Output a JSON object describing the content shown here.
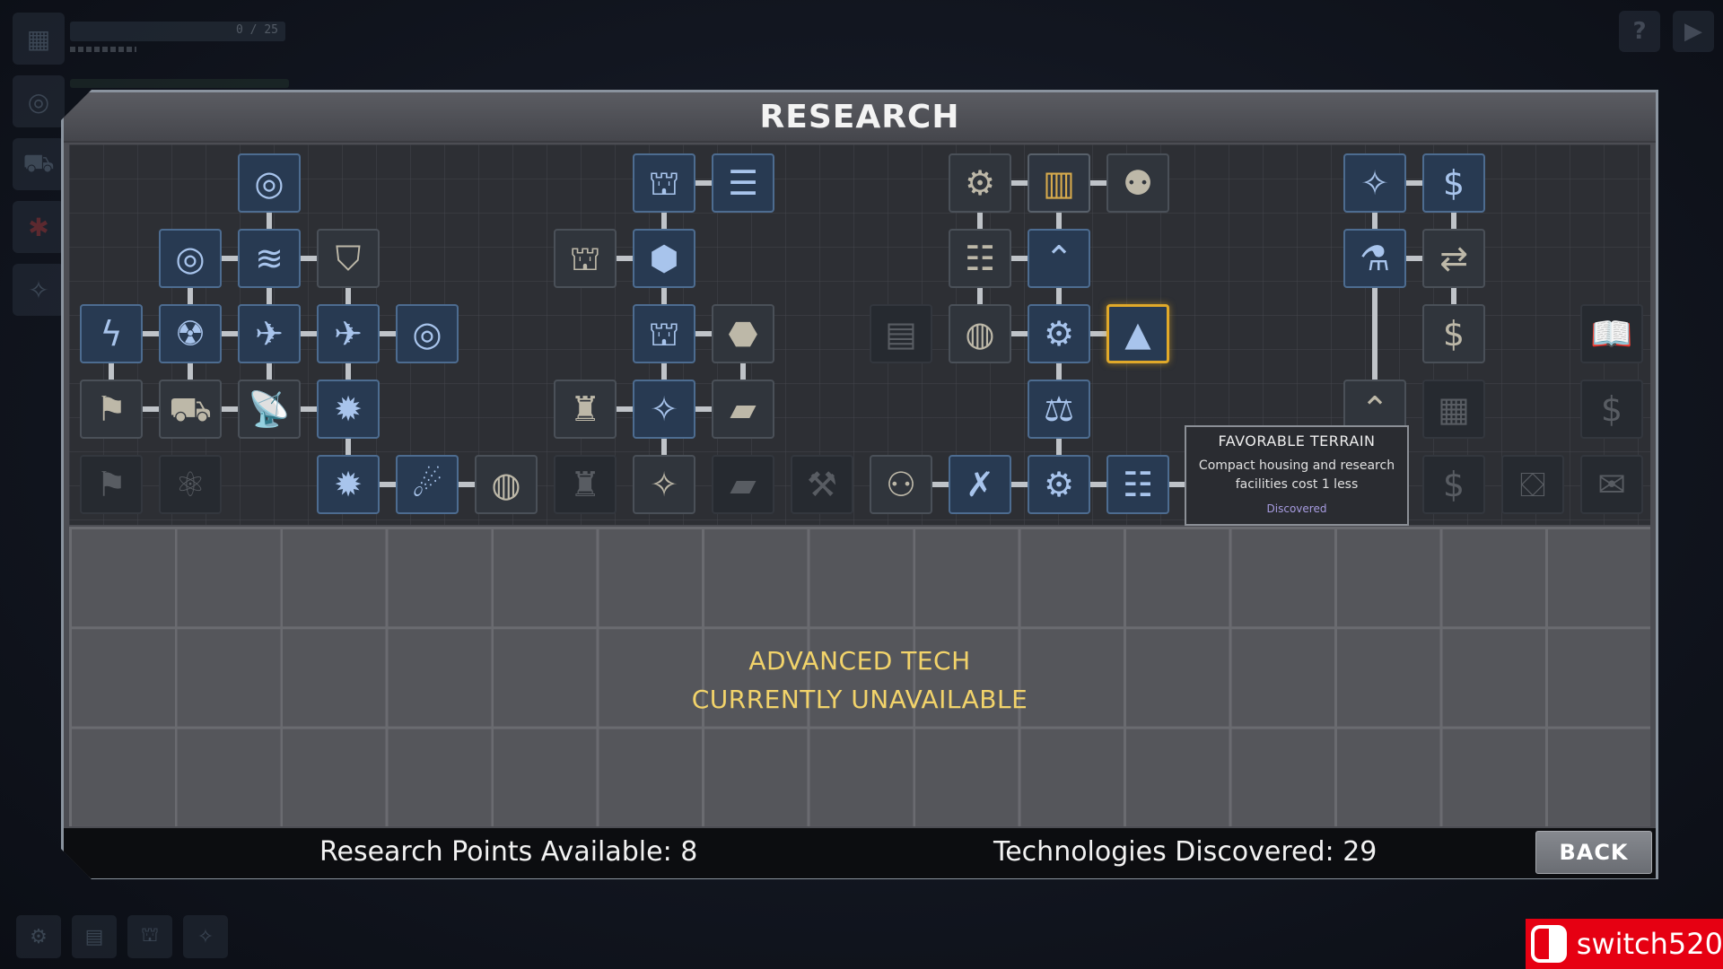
{
  "background": {
    "hud_progress": "0 / 25"
  },
  "panel": {
    "title": "RESEARCH"
  },
  "tree": {
    "nodes": [
      {
        "id": "n1",
        "col": 3,
        "row": 0,
        "state": "discovered",
        "icon": "radar-icon",
        "glyph": "◎"
      },
      {
        "id": "n2",
        "col": 2,
        "row": 1,
        "state": "discovered",
        "icon": "radar-icon",
        "glyph": "◎"
      },
      {
        "id": "n3",
        "col": 3,
        "row": 1,
        "state": "discovered",
        "icon": "signal-wave-icon",
        "glyph": "≋"
      },
      {
        "id": "n4",
        "col": 4,
        "row": 1,
        "state": "available",
        "icon": "shield-icon",
        "glyph": "⛉"
      },
      {
        "id": "n5",
        "col": 1,
        "row": 2,
        "state": "discovered",
        "icon": "lightning-icon",
        "glyph": "ϟ"
      },
      {
        "id": "n6",
        "col": 2,
        "row": 2,
        "state": "discovered",
        "icon": "reactor-icon",
        "glyph": "☢"
      },
      {
        "id": "n7",
        "col": 3,
        "row": 2,
        "state": "discovered",
        "icon": "spaceship-icon",
        "glyph": "✈"
      },
      {
        "id": "n8",
        "col": 4,
        "row": 2,
        "state": "discovered",
        "icon": "spaceship-icon",
        "glyph": "✈"
      },
      {
        "id": "n9",
        "col": 5,
        "row": 2,
        "state": "discovered",
        "icon": "radar-icon",
        "glyph": "◎"
      },
      {
        "id": "n10",
        "col": 1,
        "row": 3,
        "state": "available",
        "icon": "banner-icon",
        "glyph": "⚑"
      },
      {
        "id": "n11",
        "col": 2,
        "row": 3,
        "state": "available",
        "icon": "rover-icon",
        "glyph": "⛟"
      },
      {
        "id": "n12",
        "col": 3,
        "row": 3,
        "state": "available",
        "icon": "satellite-dish-icon",
        "glyph": "📡"
      },
      {
        "id": "n13",
        "col": 4,
        "row": 3,
        "state": "discovered",
        "icon": "spiked-mine-icon",
        "glyph": "✹"
      },
      {
        "id": "n14",
        "col": 1,
        "row": 4,
        "state": "locked",
        "icon": "banner-icon",
        "glyph": "⚑"
      },
      {
        "id": "n15",
        "col": 2,
        "row": 4,
        "state": "locked",
        "icon": "atom-icon",
        "glyph": "⚛"
      },
      {
        "id": "n16",
        "col": 4,
        "row": 4,
        "state": "discovered",
        "icon": "spiked-mine-icon",
        "glyph": "✹"
      },
      {
        "id": "n17",
        "col": 5,
        "row": 4,
        "state": "discovered",
        "icon": "comet-icon",
        "glyph": "☄"
      },
      {
        "id": "n18",
        "col": 6,
        "row": 4,
        "state": "available",
        "icon": "planet-icon",
        "glyph": "◍"
      },
      {
        "id": "n19",
        "col": 8,
        "row": 0,
        "state": "discovered",
        "icon": "oil-rig-icon",
        "glyph": "⛫"
      },
      {
        "id": "n20",
        "col": 9,
        "row": 0,
        "state": "discovered",
        "icon": "column-icon",
        "glyph": "☰"
      },
      {
        "id": "n21",
        "col": 7,
        "row": 1,
        "state": "available",
        "icon": "oil-rig-icon",
        "glyph": "⛫"
      },
      {
        "id": "n22",
        "col": 8,
        "row": 1,
        "state": "discovered",
        "icon": "cube-icon",
        "glyph": "⬢"
      },
      {
        "id": "n23",
        "col": 8,
        "row": 2,
        "state": "discovered",
        "icon": "oil-rig-icon",
        "glyph": "⛫"
      },
      {
        "id": "n24",
        "col": 9,
        "row": 2,
        "state": "available",
        "icon": "blocks-icon",
        "glyph": "⬣"
      },
      {
        "id": "n25",
        "col": 7,
        "row": 3,
        "state": "available",
        "icon": "mech-suit-icon",
        "glyph": "♜"
      },
      {
        "id": "n26",
        "col": 8,
        "row": 3,
        "state": "discovered",
        "icon": "crystal-icon",
        "glyph": "✧"
      },
      {
        "id": "n27",
        "col": 9,
        "row": 3,
        "state": "available",
        "icon": "ingot-icon",
        "glyph": "▰"
      },
      {
        "id": "n28",
        "col": 7,
        "row": 4,
        "state": "locked",
        "icon": "mech-suit-icon",
        "glyph": "♜"
      },
      {
        "id": "n29",
        "col": 8,
        "row": 4,
        "state": "available",
        "icon": "crystal-icon",
        "glyph": "✧"
      },
      {
        "id": "n30",
        "col": 9,
        "row": 4,
        "state": "locked",
        "icon": "ingot-icon",
        "glyph": "▰"
      },
      {
        "id": "n31",
        "col": 10,
        "row": 4,
        "state": "locked",
        "icon": "drill-icon",
        "glyph": "⚒"
      },
      {
        "id": "n32",
        "col": 11,
        "row": 2,
        "state": "locked",
        "icon": "money-stack-icon",
        "glyph": "▤"
      },
      {
        "id": "n33",
        "col": 11,
        "row": 4,
        "state": "available",
        "icon": "hierarchy-icon",
        "glyph": "⚇"
      },
      {
        "id": "n34",
        "col": 12,
        "row": 0,
        "state": "available",
        "icon": "gear-wrench-icon",
        "glyph": "⚙"
      },
      {
        "id": "n35",
        "col": 13,
        "row": 0,
        "state": "gold",
        "icon": "city-icon",
        "glyph": "▥"
      },
      {
        "id": "n36",
        "col": 14,
        "row": 0,
        "state": "available",
        "icon": "population-icon",
        "glyph": "⚉"
      },
      {
        "id": "n37",
        "col": 12,
        "row": 1,
        "state": "available",
        "icon": "layers-icon",
        "glyph": "☷"
      },
      {
        "id": "n38",
        "col": 13,
        "row": 1,
        "state": "discovered",
        "icon": "rank-chevron-icon",
        "glyph": "⌃"
      },
      {
        "id": "n39",
        "col": 12,
        "row": 2,
        "state": "available",
        "icon": "planet-icon",
        "glyph": "◍"
      },
      {
        "id": "n40",
        "col": 13,
        "row": 2,
        "state": "discovered",
        "icon": "gear-wrench-icon",
        "glyph": "⚙"
      },
      {
        "id": "n41",
        "col": 14,
        "row": 2,
        "state": "discovered",
        "icon": "mountain-icon",
        "glyph": "▲",
        "selected": true
      },
      {
        "id": "n42",
        "col": 13,
        "row": 3,
        "state": "discovered",
        "icon": "balance-scale-icon",
        "glyph": "⚖"
      },
      {
        "id": "n43",
        "col": 12,
        "row": 4,
        "state": "discovered",
        "icon": "wrench-cross-icon",
        "glyph": "✗"
      },
      {
        "id": "n44",
        "col": 13,
        "row": 4,
        "state": "discovered",
        "icon": "gear-wrench-icon",
        "glyph": "⚙"
      },
      {
        "id": "n45",
        "col": 14,
        "row": 4,
        "state": "discovered",
        "icon": "layers-icon",
        "glyph": "☷"
      },
      {
        "id": "n46",
        "col": 15,
        "row": 4,
        "state": "available",
        "icon": "pyramid-icon",
        "glyph": "▲"
      },
      {
        "id": "n47",
        "col": 16,
        "row": 4,
        "state": "locked",
        "icon": "cross-swords-icon",
        "glyph": "✕"
      },
      {
        "id": "n48",
        "col": 17,
        "row": 0,
        "state": "discovered",
        "icon": "crystal-icon",
        "glyph": "✧"
      },
      {
        "id": "n49",
        "col": 18,
        "row": 0,
        "state": "discovered",
        "icon": "coin-bag-icon",
        "glyph": "$"
      },
      {
        "id": "n50",
        "col": 17,
        "row": 1,
        "state": "discovered",
        "icon": "flask-icon",
        "glyph": "⚗"
      },
      {
        "id": "n51",
        "col": 18,
        "row": 1,
        "state": "available",
        "icon": "exchange-icon",
        "glyph": "⇄"
      },
      {
        "id": "n52",
        "col": 18,
        "row": 2,
        "state": "available",
        "icon": "coin-bag-icon",
        "glyph": "$"
      },
      {
        "id": "n53",
        "col": 17,
        "row": 3,
        "state": "available",
        "icon": "rank-chevron-icon",
        "glyph": "⌃"
      },
      {
        "id": "n54",
        "col": 18,
        "row": 3,
        "state": "locked",
        "icon": "bricks-icon",
        "glyph": "▦"
      },
      {
        "id": "n55",
        "col": 17,
        "row": 4,
        "state": "locked",
        "icon": "rank-chevron-icon",
        "glyph": "⌃"
      },
      {
        "id": "n56",
        "col": 18,
        "row": 4,
        "state": "locked",
        "icon": "coin-bag-icon",
        "glyph": "$"
      },
      {
        "id": "n57",
        "col": 19,
        "row": 4,
        "state": "locked",
        "icon": "treasure-chest-icon",
        "glyph": "⛋"
      },
      {
        "id": "n58",
        "col": 20,
        "row": 2,
        "state": "locked",
        "icon": "book-icon",
        "glyph": "📖"
      },
      {
        "id": "n59",
        "col": 20,
        "row": 3,
        "state": "locked",
        "icon": "coin-bag-icon",
        "glyph": "$"
      },
      {
        "id": "n60",
        "col": 20,
        "row": 4,
        "state": "locked",
        "icon": "chat-bubbles-icon",
        "glyph": "✉"
      }
    ],
    "links": [
      [
        "n1",
        "n3"
      ],
      [
        "n2",
        "n3"
      ],
      [
        "n3",
        "n4"
      ],
      [
        "n2",
        "n6"
      ],
      [
        "n3",
        "n7"
      ],
      [
        "n4",
        "n8"
      ],
      [
        "n5",
        "n6"
      ],
      [
        "n6",
        "n7"
      ],
      [
        "n7",
        "n8"
      ],
      [
        "n8",
        "n9"
      ],
      [
        "n5",
        "n10"
      ],
      [
        "n6",
        "n11"
      ],
      [
        "n7",
        "n12"
      ],
      [
        "n8",
        "n13"
      ],
      [
        "n10",
        "n11"
      ],
      [
        "n11",
        "n12"
      ],
      [
        "n12",
        "n13"
      ],
      [
        "n13",
        "n16"
      ],
      [
        "n16",
        "n17"
      ],
      [
        "n17",
        "n18"
      ],
      [
        "n19",
        "n20"
      ],
      [
        "n19",
        "n22"
      ],
      [
        "n21",
        "n22"
      ],
      [
        "n22",
        "n23"
      ],
      [
        "n23",
        "n24"
      ],
      [
        "n23",
        "n26"
      ],
      [
        "n24",
        "n27"
      ],
      [
        "n25",
        "n26"
      ],
      [
        "n26",
        "n27"
      ],
      [
        "n26",
        "n29"
      ],
      [
        "n34",
        "n35"
      ],
      [
        "n35",
        "n36"
      ],
      [
        "n34",
        "n37"
      ],
      [
        "n35",
        "n38"
      ],
      [
        "n37",
        "n38"
      ],
      [
        "n37",
        "n39"
      ],
      [
        "n38",
        "n40"
      ],
      [
        "n39",
        "n40"
      ],
      [
        "n40",
        "n41"
      ],
      [
        "n40",
        "n42"
      ],
      [
        "n42",
        "n44"
      ],
      [
        "n33",
        "n43"
      ],
      [
        "n43",
        "n44"
      ],
      [
        "n44",
        "n45"
      ],
      [
        "n45",
        "n46"
      ],
      [
        "n48",
        "n49"
      ],
      [
        "n48",
        "n50"
      ],
      [
        "n49",
        "n51"
      ],
      [
        "n50",
        "n51"
      ],
      [
        "n51",
        "n52"
      ],
      [
        "n50",
        "n53"
      ]
    ]
  },
  "tooltip": {
    "title": "FAVORABLE TERRAIN",
    "line1": "Compact housing and research",
    "line2": "facilities cost 1 less",
    "status": "Discovered"
  },
  "advanced": {
    "line1": "ADVANCED TECH",
    "line2": "CURRENTLY UNAVAILABLE"
  },
  "footer": {
    "research_points": "Research Points Available: 8",
    "technologies": "Technologies Discovered: 29",
    "back_label": "BACK"
  },
  "watermark": {
    "text": "switch520"
  },
  "colors": {
    "discovered": "#283a52",
    "selected_border": "#e0a92a",
    "advanced_text": "#f2d36a",
    "tooltip_status": "#a79ce0"
  }
}
